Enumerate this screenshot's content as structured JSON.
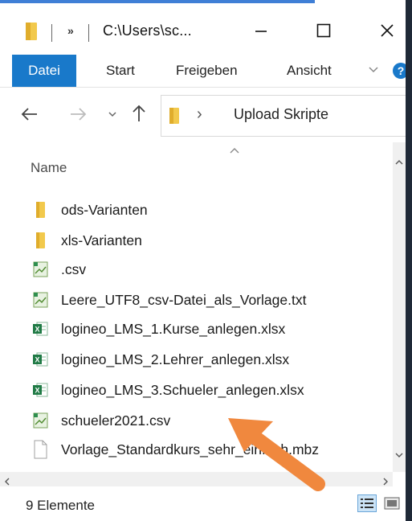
{
  "window": {
    "title": "C:\\Users\\sc...",
    "qat_more": "»"
  },
  "ribbon": {
    "tabs": [
      {
        "label": "Datei",
        "active": true
      },
      {
        "label": "Start",
        "active": false
      },
      {
        "label": "Freigeben",
        "active": false
      },
      {
        "label": "Ansicht",
        "active": false
      }
    ]
  },
  "address": {
    "separator": "›",
    "current_folder": "Upload Skripte"
  },
  "list": {
    "column_header": "Name",
    "files": [
      {
        "name": "ods-Varianten",
        "icon": "folder-icon"
      },
      {
        "name": "xls-Varianten",
        "icon": "folder-icon"
      },
      {
        "name": ".csv",
        "icon": "csv-file-icon"
      },
      {
        "name": "Leere_UTF8_csv-Datei_als_Vorlage.txt",
        "icon": "csv-file-icon"
      },
      {
        "name": "logineo_LMS_1.Kurse_anlegen.xlsx",
        "icon": "excel-file-icon"
      },
      {
        "name": "logineo_LMS_2.Lehrer_anlegen.xlsx",
        "icon": "excel-file-icon"
      },
      {
        "name": "logineo_LMS_3.Schueler_anlegen.xlsx",
        "icon": "excel-file-icon"
      },
      {
        "name": "schueler2021.csv",
        "icon": "csv-file-icon"
      },
      {
        "name": "Vorlage_Standardkurs_sehr_einfach.mbz",
        "icon": "blank-file-icon"
      }
    ]
  },
  "status": {
    "item_count": "9 Elemente"
  },
  "colors": {
    "accent": "#1979ca",
    "folder": "#f2c94c",
    "excel": "#1f7a45",
    "annotation_arrow": "#f0883e"
  }
}
